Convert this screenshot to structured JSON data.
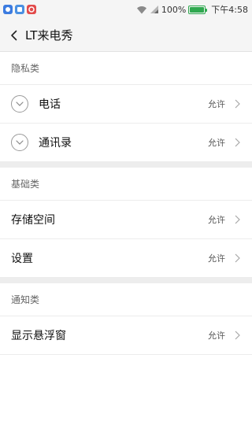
{
  "status_bar": {
    "battery": "100%",
    "time": "下午4:58",
    "battery_level": 1.0,
    "notif_icons": [
      "app-notification-icon",
      "app-notification-icon",
      "app-notification-icon"
    ]
  },
  "header": {
    "title": "LT来电秀"
  },
  "sections": {
    "privacy": {
      "title": "隐私类",
      "items": [
        {
          "label": "电话",
          "status": "允许"
        },
        {
          "label": "通讯录",
          "status": "允许"
        }
      ]
    },
    "basic": {
      "title": "基础类",
      "items": [
        {
          "label": "存储空间",
          "status": "允许"
        },
        {
          "label": "设置",
          "status": "允许"
        }
      ]
    },
    "notification": {
      "title": "通知类",
      "items": [
        {
          "label": "显示悬浮窗",
          "status": "允许"
        }
      ]
    }
  },
  "colors": {
    "accent_battery": "#2fa84f",
    "notif_1": "#3b7be0",
    "notif_2": "#4a90e2",
    "notif_3": "#e24b4b"
  }
}
